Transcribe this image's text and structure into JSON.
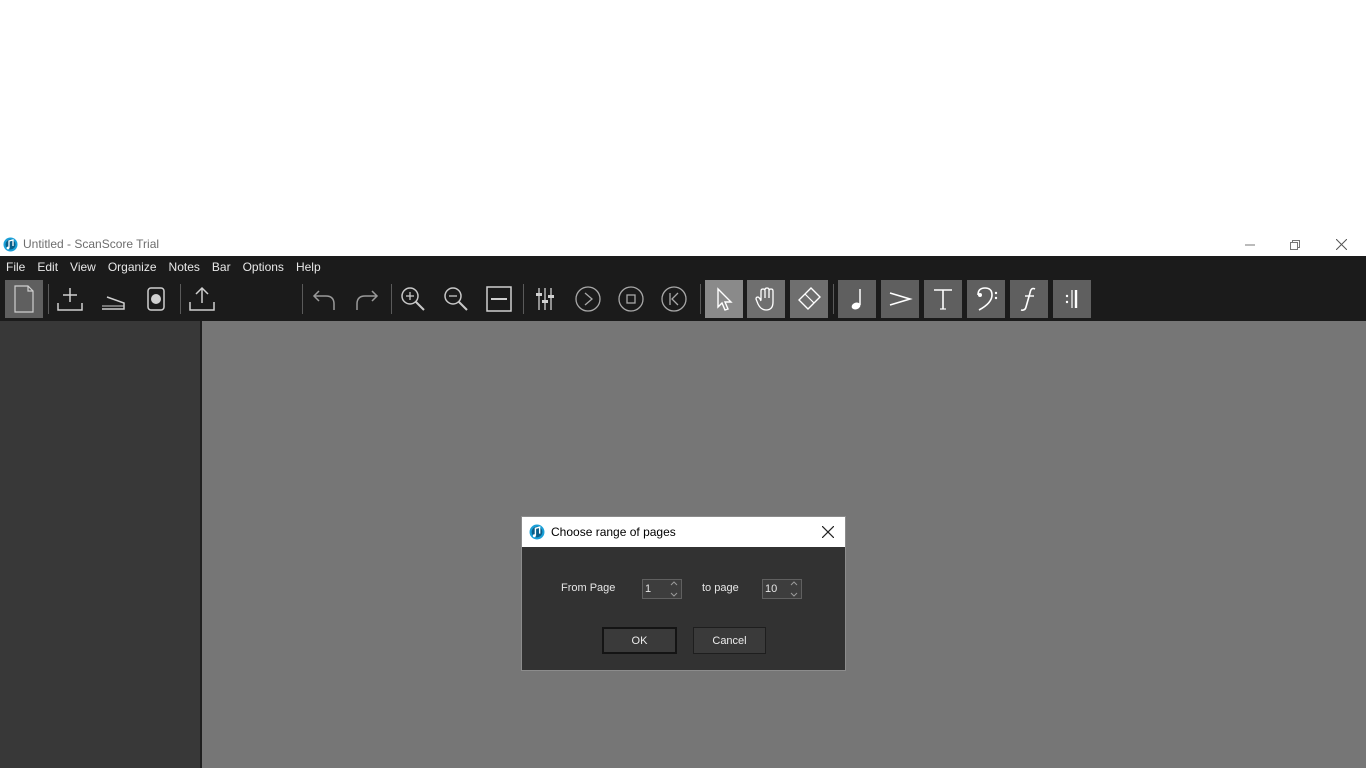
{
  "window": {
    "title": "Untitled - ScanScore Trial"
  },
  "menu": {
    "items": [
      "File",
      "Edit",
      "View",
      "Organize",
      "Notes",
      "Bar",
      "Options",
      "Help"
    ]
  },
  "toolbar": {
    "icons": [
      "new-document-icon",
      "add-import-icon",
      "scan-icon",
      "smartscore-icon",
      "export-icon",
      "undo-icon",
      "redo-icon",
      "zoom-in-icon",
      "zoom-out-icon",
      "fit-width-icon",
      "mixer-icon",
      "play-icon",
      "stop-icon",
      "rewind-icon",
      "select-icon",
      "hand-icon",
      "eraser-icon",
      "note-icon",
      "accent-icon",
      "text-icon",
      "clef-icon",
      "dynamics-icon",
      "barline-icon"
    ]
  },
  "dialog": {
    "title": "Choose range of pages",
    "from_label": "From Page",
    "from_value": "1",
    "to_label": "to page",
    "to_value": "10",
    "ok_label": "OK",
    "cancel_label": "Cancel"
  },
  "colors": {
    "menubar": "#1b1b1b",
    "left_panel": "#383838",
    "workspace": "#767676",
    "dialog_body": "#323232",
    "active_tool": "#8a8a8a",
    "app_icon": "#1aa0d8"
  }
}
